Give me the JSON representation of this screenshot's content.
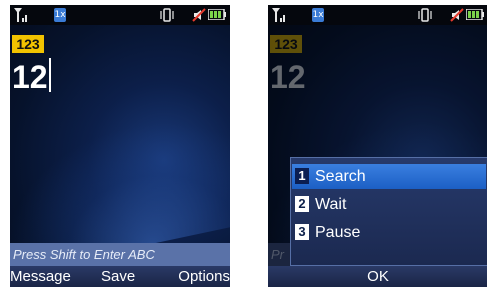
{
  "status_bar": {
    "network_indicator": "1x",
    "icons": [
      "signal-strength-icon",
      "network-1x-icon",
      "vibrate-icon",
      "mute-icon",
      "battery-icon"
    ]
  },
  "left_screen": {
    "input_mode": "123",
    "entered_number": "12",
    "hint": "Press Shift to Enter ABC",
    "softkeys": {
      "left": "Message",
      "center": "Save",
      "right": "Options"
    }
  },
  "right_screen": {
    "input_mode": "123",
    "entered_number": "12",
    "hint_partial": "Pr",
    "menu": [
      {
        "number": "1",
        "label": "Search",
        "selected": true
      },
      {
        "number": "2",
        "label": "Wait",
        "selected": false
      },
      {
        "number": "3",
        "label": "Pause",
        "selected": false
      }
    ],
    "softkey_center": "OK"
  },
  "colors": {
    "mode_badge": "#f2c300",
    "selection": "#2f74d6",
    "background": "#0c1f4a"
  }
}
